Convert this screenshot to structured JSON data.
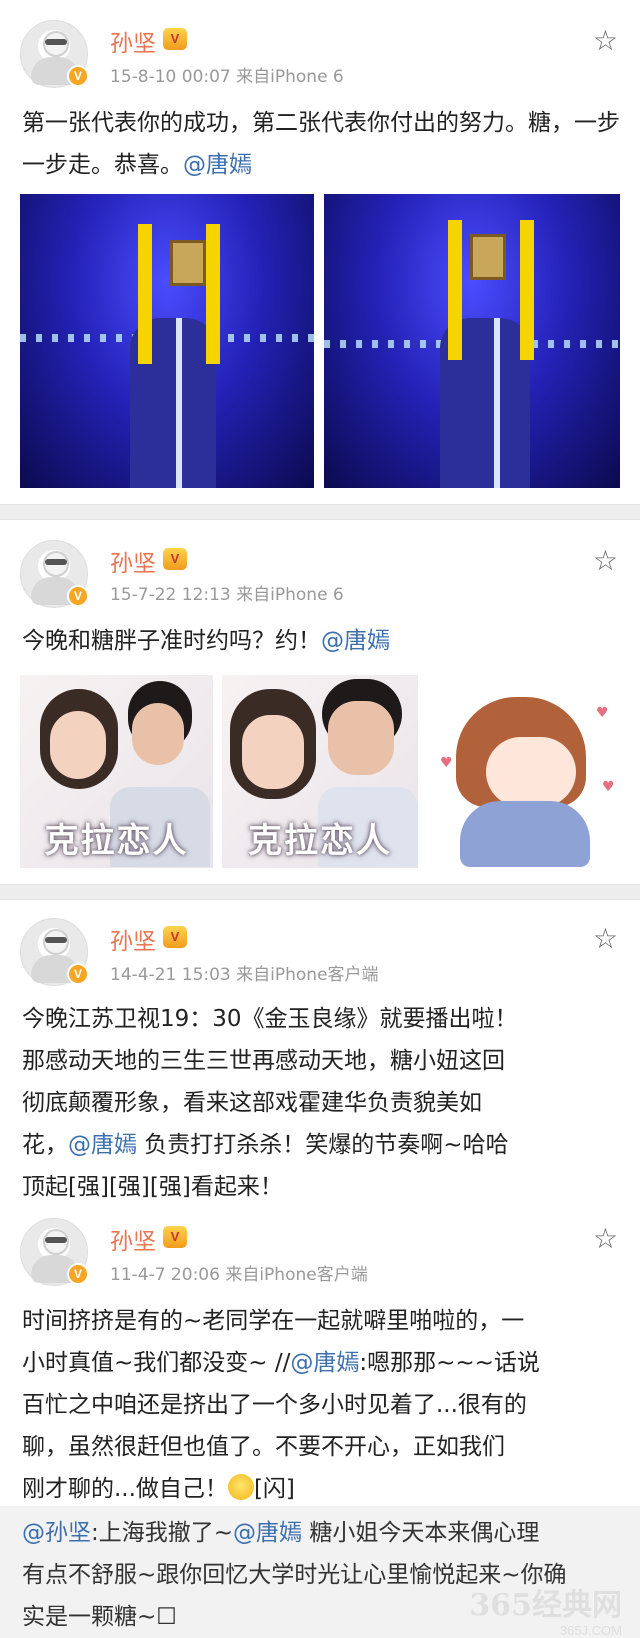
{
  "posts": [
    {
      "author": "孙坚",
      "meta": "15-8-10 00:07  来自iPhone 6",
      "text_before": "第一张代表你的成功，第二张代表你付出的努力。糖，一步一步走。恭喜。",
      "mention": "@唐嫣",
      "images": [
        "stage-photo-1",
        "stage-photo-2"
      ]
    },
    {
      "author": "孙坚",
      "meta": "15-7-22 12:13  来自iPhone 6",
      "text_before": "今晚和糖胖子准时约吗？约！",
      "mention": "@唐嫣",
      "images": [
        "poster-1",
        "poster-2",
        "cartoon-drawing"
      ],
      "poster_logo": "克拉恋人"
    },
    {
      "author": "孙坚",
      "meta": "14-4-21 15:03  来自iPhone客户端",
      "line1": "今晚江苏卫视19：30《金玉良缘》就要播出啦！",
      "line2": "那感动天地的三生三世再感动天地，糖小妞这回",
      "line3": "彻底颠覆形象，看来这部戏霍建华负责貌美如",
      "line4_before": "花，",
      "line4_mention": "@唐嫣",
      "line4_after": " 负责打打杀杀！笑爆的节奏啊~哈哈",
      "line5": "顶起[强][强][强]看起来！"
    },
    {
      "author": "孙坚",
      "meta": "11-4-7 20:06  来自iPhone客户端",
      "line1": "时间挤挤是有的~老同学在一起就噼里啪啦的，一",
      "line2_before": "小时真值~我们都没变~ //",
      "line2_mention": "@唐嫣",
      "line2_after": ":嗯那那~~~话说",
      "line3": "百忙之中咱还是挤出了一个多小时见着了...很有的",
      "line4": "聊，虽然很赶但也值了。不要不开心，正如我们",
      "line5_before": "刚才聊的...做自己！",
      "line5_after": "[闪]",
      "repost_mention1": "@孙坚",
      "repost_after1": ":上海我撤了~",
      "repost_mention2": "@唐嫣",
      "repost_after2": "   糖小姐今天本来偶心理",
      "repost_line2": "有点不舒服~跟你回忆大学时光让心里愉悦起来~你确",
      "repost_line3": "实是一颗糖~☐"
    }
  ],
  "icons": {
    "star": "star-outline-icon",
    "vip": "crown-icon",
    "verified": "verified-badge-icon"
  },
  "colors": {
    "author": "#eb7350",
    "mention": "#3c6fae",
    "meta": "#999999",
    "separator": "#ededed"
  },
  "badges": {
    "vip_text": "V",
    "verified_text": "V"
  },
  "watermark": {
    "main": "365经典网",
    "sub": "365J.COM"
  }
}
